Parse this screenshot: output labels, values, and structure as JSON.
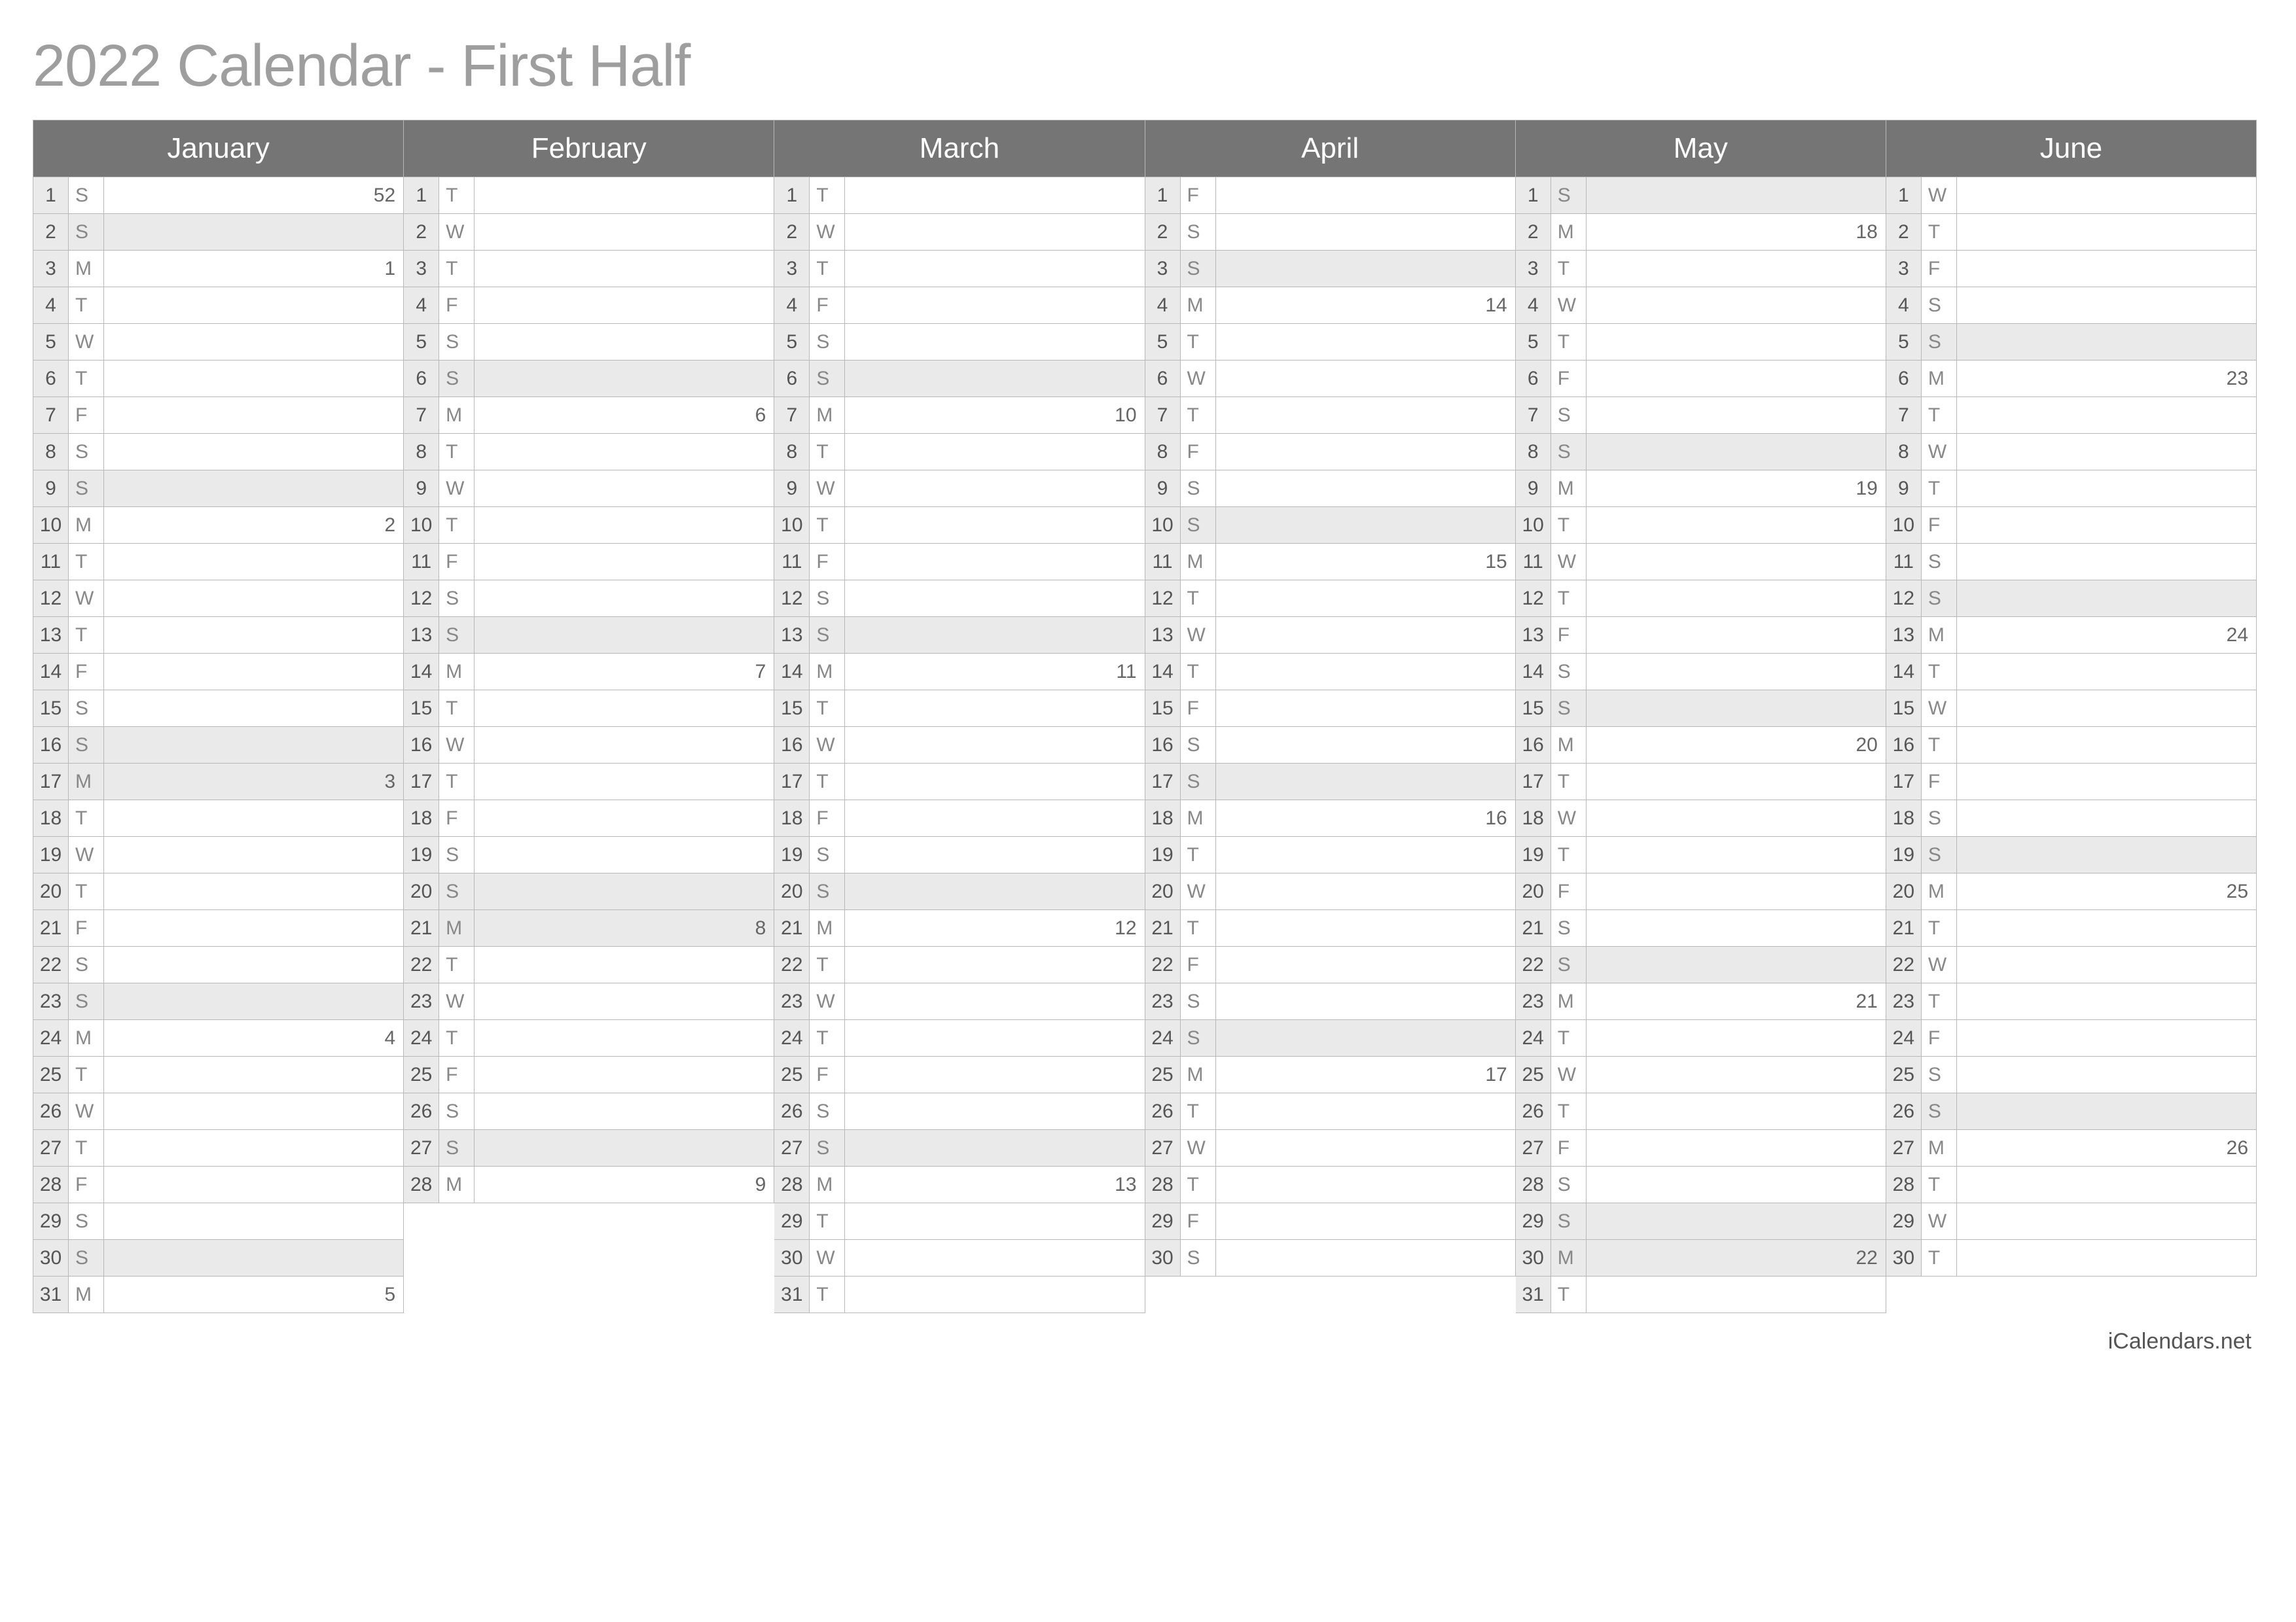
{
  "title": "2022 Calendar - First Half",
  "footer": "iCalendars.net",
  "months": [
    {
      "name": "January",
      "days": [
        {
          "n": 1,
          "d": "S",
          "w": "52",
          "shade": false
        },
        {
          "n": 2,
          "d": "S",
          "w": "",
          "shade": true
        },
        {
          "n": 3,
          "d": "M",
          "w": "1",
          "shade": false
        },
        {
          "n": 4,
          "d": "T",
          "w": "",
          "shade": false
        },
        {
          "n": 5,
          "d": "W",
          "w": "",
          "shade": false
        },
        {
          "n": 6,
          "d": "T",
          "w": "",
          "shade": false
        },
        {
          "n": 7,
          "d": "F",
          "w": "",
          "shade": false
        },
        {
          "n": 8,
          "d": "S",
          "w": "",
          "shade": false
        },
        {
          "n": 9,
          "d": "S",
          "w": "",
          "shade": true
        },
        {
          "n": 10,
          "d": "M",
          "w": "2",
          "shade": false
        },
        {
          "n": 11,
          "d": "T",
          "w": "",
          "shade": false
        },
        {
          "n": 12,
          "d": "W",
          "w": "",
          "shade": false
        },
        {
          "n": 13,
          "d": "T",
          "w": "",
          "shade": false
        },
        {
          "n": 14,
          "d": "F",
          "w": "",
          "shade": false
        },
        {
          "n": 15,
          "d": "S",
          "w": "",
          "shade": false
        },
        {
          "n": 16,
          "d": "S",
          "w": "",
          "shade": true
        },
        {
          "n": 17,
          "d": "M",
          "w": "3",
          "shade": true
        },
        {
          "n": 18,
          "d": "T",
          "w": "",
          "shade": false
        },
        {
          "n": 19,
          "d": "W",
          "w": "",
          "shade": false
        },
        {
          "n": 20,
          "d": "T",
          "w": "",
          "shade": false
        },
        {
          "n": 21,
          "d": "F",
          "w": "",
          "shade": false
        },
        {
          "n": 22,
          "d": "S",
          "w": "",
          "shade": false
        },
        {
          "n": 23,
          "d": "S",
          "w": "",
          "shade": true
        },
        {
          "n": 24,
          "d": "M",
          "w": "4",
          "shade": false
        },
        {
          "n": 25,
          "d": "T",
          "w": "",
          "shade": false
        },
        {
          "n": 26,
          "d": "W",
          "w": "",
          "shade": false
        },
        {
          "n": 27,
          "d": "T",
          "w": "",
          "shade": false
        },
        {
          "n": 28,
          "d": "F",
          "w": "",
          "shade": false
        },
        {
          "n": 29,
          "d": "S",
          "w": "",
          "shade": false
        },
        {
          "n": 30,
          "d": "S",
          "w": "",
          "shade": true
        },
        {
          "n": 31,
          "d": "M",
          "w": "5",
          "shade": false
        }
      ]
    },
    {
      "name": "February",
      "days": [
        {
          "n": 1,
          "d": "T",
          "w": "",
          "shade": false
        },
        {
          "n": 2,
          "d": "W",
          "w": "",
          "shade": false
        },
        {
          "n": 3,
          "d": "T",
          "w": "",
          "shade": false
        },
        {
          "n": 4,
          "d": "F",
          "w": "",
          "shade": false
        },
        {
          "n": 5,
          "d": "S",
          "w": "",
          "shade": false
        },
        {
          "n": 6,
          "d": "S",
          "w": "",
          "shade": true
        },
        {
          "n": 7,
          "d": "M",
          "w": "6",
          "shade": false
        },
        {
          "n": 8,
          "d": "T",
          "w": "",
          "shade": false
        },
        {
          "n": 9,
          "d": "W",
          "w": "",
          "shade": false
        },
        {
          "n": 10,
          "d": "T",
          "w": "",
          "shade": false
        },
        {
          "n": 11,
          "d": "F",
          "w": "",
          "shade": false
        },
        {
          "n": 12,
          "d": "S",
          "w": "",
          "shade": false
        },
        {
          "n": 13,
          "d": "S",
          "w": "",
          "shade": true
        },
        {
          "n": 14,
          "d": "M",
          "w": "7",
          "shade": false
        },
        {
          "n": 15,
          "d": "T",
          "w": "",
          "shade": false
        },
        {
          "n": 16,
          "d": "W",
          "w": "",
          "shade": false
        },
        {
          "n": 17,
          "d": "T",
          "w": "",
          "shade": false
        },
        {
          "n": 18,
          "d": "F",
          "w": "",
          "shade": false
        },
        {
          "n": 19,
          "d": "S",
          "w": "",
          "shade": false
        },
        {
          "n": 20,
          "d": "S",
          "w": "",
          "shade": true
        },
        {
          "n": 21,
          "d": "M",
          "w": "8",
          "shade": true
        },
        {
          "n": 22,
          "d": "T",
          "w": "",
          "shade": false
        },
        {
          "n": 23,
          "d": "W",
          "w": "",
          "shade": false
        },
        {
          "n": 24,
          "d": "T",
          "w": "",
          "shade": false
        },
        {
          "n": 25,
          "d": "F",
          "w": "",
          "shade": false
        },
        {
          "n": 26,
          "d": "S",
          "w": "",
          "shade": false
        },
        {
          "n": 27,
          "d": "S",
          "w": "",
          "shade": true
        },
        {
          "n": 28,
          "d": "M",
          "w": "9",
          "shade": false
        }
      ]
    },
    {
      "name": "March",
      "days": [
        {
          "n": 1,
          "d": "T",
          "w": "",
          "shade": false
        },
        {
          "n": 2,
          "d": "W",
          "w": "",
          "shade": false
        },
        {
          "n": 3,
          "d": "T",
          "w": "",
          "shade": false
        },
        {
          "n": 4,
          "d": "F",
          "w": "",
          "shade": false
        },
        {
          "n": 5,
          "d": "S",
          "w": "",
          "shade": false
        },
        {
          "n": 6,
          "d": "S",
          "w": "",
          "shade": true
        },
        {
          "n": 7,
          "d": "M",
          "w": "10",
          "shade": false
        },
        {
          "n": 8,
          "d": "T",
          "w": "",
          "shade": false
        },
        {
          "n": 9,
          "d": "W",
          "w": "",
          "shade": false
        },
        {
          "n": 10,
          "d": "T",
          "w": "",
          "shade": false
        },
        {
          "n": 11,
          "d": "F",
          "w": "",
          "shade": false
        },
        {
          "n": 12,
          "d": "S",
          "w": "",
          "shade": false
        },
        {
          "n": 13,
          "d": "S",
          "w": "",
          "shade": true
        },
        {
          "n": 14,
          "d": "M",
          "w": "11",
          "shade": false
        },
        {
          "n": 15,
          "d": "T",
          "w": "",
          "shade": false
        },
        {
          "n": 16,
          "d": "W",
          "w": "",
          "shade": false
        },
        {
          "n": 17,
          "d": "T",
          "w": "",
          "shade": false
        },
        {
          "n": 18,
          "d": "F",
          "w": "",
          "shade": false
        },
        {
          "n": 19,
          "d": "S",
          "w": "",
          "shade": false
        },
        {
          "n": 20,
          "d": "S",
          "w": "",
          "shade": true
        },
        {
          "n": 21,
          "d": "M",
          "w": "12",
          "shade": false
        },
        {
          "n": 22,
          "d": "T",
          "w": "",
          "shade": false
        },
        {
          "n": 23,
          "d": "W",
          "w": "",
          "shade": false
        },
        {
          "n": 24,
          "d": "T",
          "w": "",
          "shade": false
        },
        {
          "n": 25,
          "d": "F",
          "w": "",
          "shade": false
        },
        {
          "n": 26,
          "d": "S",
          "w": "",
          "shade": false
        },
        {
          "n": 27,
          "d": "S",
          "w": "",
          "shade": true
        },
        {
          "n": 28,
          "d": "M",
          "w": "13",
          "shade": false
        },
        {
          "n": 29,
          "d": "T",
          "w": "",
          "shade": false
        },
        {
          "n": 30,
          "d": "W",
          "w": "",
          "shade": false
        },
        {
          "n": 31,
          "d": "T",
          "w": "",
          "shade": false
        }
      ]
    },
    {
      "name": "April",
      "days": [
        {
          "n": 1,
          "d": "F",
          "w": "",
          "shade": false
        },
        {
          "n": 2,
          "d": "S",
          "w": "",
          "shade": false
        },
        {
          "n": 3,
          "d": "S",
          "w": "",
          "shade": true
        },
        {
          "n": 4,
          "d": "M",
          "w": "14",
          "shade": false
        },
        {
          "n": 5,
          "d": "T",
          "w": "",
          "shade": false
        },
        {
          "n": 6,
          "d": "W",
          "w": "",
          "shade": false
        },
        {
          "n": 7,
          "d": "T",
          "w": "",
          "shade": false
        },
        {
          "n": 8,
          "d": "F",
          "w": "",
          "shade": false
        },
        {
          "n": 9,
          "d": "S",
          "w": "",
          "shade": false
        },
        {
          "n": 10,
          "d": "S",
          "w": "",
          "shade": true
        },
        {
          "n": 11,
          "d": "M",
          "w": "15",
          "shade": false
        },
        {
          "n": 12,
          "d": "T",
          "w": "",
          "shade": false
        },
        {
          "n": 13,
          "d": "W",
          "w": "",
          "shade": false
        },
        {
          "n": 14,
          "d": "T",
          "w": "",
          "shade": false
        },
        {
          "n": 15,
          "d": "F",
          "w": "",
          "shade": false
        },
        {
          "n": 16,
          "d": "S",
          "w": "",
          "shade": false
        },
        {
          "n": 17,
          "d": "S",
          "w": "",
          "shade": true
        },
        {
          "n": 18,
          "d": "M",
          "w": "16",
          "shade": false
        },
        {
          "n": 19,
          "d": "T",
          "w": "",
          "shade": false
        },
        {
          "n": 20,
          "d": "W",
          "w": "",
          "shade": false
        },
        {
          "n": 21,
          "d": "T",
          "w": "",
          "shade": false
        },
        {
          "n": 22,
          "d": "F",
          "w": "",
          "shade": false
        },
        {
          "n": 23,
          "d": "S",
          "w": "",
          "shade": false
        },
        {
          "n": 24,
          "d": "S",
          "w": "",
          "shade": true
        },
        {
          "n": 25,
          "d": "M",
          "w": "17",
          "shade": false
        },
        {
          "n": 26,
          "d": "T",
          "w": "",
          "shade": false
        },
        {
          "n": 27,
          "d": "W",
          "w": "",
          "shade": false
        },
        {
          "n": 28,
          "d": "T",
          "w": "",
          "shade": false
        },
        {
          "n": 29,
          "d": "F",
          "w": "",
          "shade": false
        },
        {
          "n": 30,
          "d": "S",
          "w": "",
          "shade": false
        }
      ]
    },
    {
      "name": "May",
      "days": [
        {
          "n": 1,
          "d": "S",
          "w": "",
          "shade": true
        },
        {
          "n": 2,
          "d": "M",
          "w": "18",
          "shade": false
        },
        {
          "n": 3,
          "d": "T",
          "w": "",
          "shade": false
        },
        {
          "n": 4,
          "d": "W",
          "w": "",
          "shade": false
        },
        {
          "n": 5,
          "d": "T",
          "w": "",
          "shade": false
        },
        {
          "n": 6,
          "d": "F",
          "w": "",
          "shade": false
        },
        {
          "n": 7,
          "d": "S",
          "w": "",
          "shade": false
        },
        {
          "n": 8,
          "d": "S",
          "w": "",
          "shade": true
        },
        {
          "n": 9,
          "d": "M",
          "w": "19",
          "shade": false
        },
        {
          "n": 10,
          "d": "T",
          "w": "",
          "shade": false
        },
        {
          "n": 11,
          "d": "W",
          "w": "",
          "shade": false
        },
        {
          "n": 12,
          "d": "T",
          "w": "",
          "shade": false
        },
        {
          "n": 13,
          "d": "F",
          "w": "",
          "shade": false
        },
        {
          "n": 14,
          "d": "S",
          "w": "",
          "shade": false
        },
        {
          "n": 15,
          "d": "S",
          "w": "",
          "shade": true
        },
        {
          "n": 16,
          "d": "M",
          "w": "20",
          "shade": false
        },
        {
          "n": 17,
          "d": "T",
          "w": "",
          "shade": false
        },
        {
          "n": 18,
          "d": "W",
          "w": "",
          "shade": false
        },
        {
          "n": 19,
          "d": "T",
          "w": "",
          "shade": false
        },
        {
          "n": 20,
          "d": "F",
          "w": "",
          "shade": false
        },
        {
          "n": 21,
          "d": "S",
          "w": "",
          "shade": false
        },
        {
          "n": 22,
          "d": "S",
          "w": "",
          "shade": true
        },
        {
          "n": 23,
          "d": "M",
          "w": "21",
          "shade": false
        },
        {
          "n": 24,
          "d": "T",
          "w": "",
          "shade": false
        },
        {
          "n": 25,
          "d": "W",
          "w": "",
          "shade": false
        },
        {
          "n": 26,
          "d": "T",
          "w": "",
          "shade": false
        },
        {
          "n": 27,
          "d": "F",
          "w": "",
          "shade": false
        },
        {
          "n": 28,
          "d": "S",
          "w": "",
          "shade": false
        },
        {
          "n": 29,
          "d": "S",
          "w": "",
          "shade": true
        },
        {
          "n": 30,
          "d": "M",
          "w": "22",
          "shade": true
        },
        {
          "n": 31,
          "d": "T",
          "w": "",
          "shade": false
        }
      ]
    },
    {
      "name": "June",
      "days": [
        {
          "n": 1,
          "d": "W",
          "w": "",
          "shade": false
        },
        {
          "n": 2,
          "d": "T",
          "w": "",
          "shade": false
        },
        {
          "n": 3,
          "d": "F",
          "w": "",
          "shade": false
        },
        {
          "n": 4,
          "d": "S",
          "w": "",
          "shade": false
        },
        {
          "n": 5,
          "d": "S",
          "w": "",
          "shade": true
        },
        {
          "n": 6,
          "d": "M",
          "w": "23",
          "shade": false
        },
        {
          "n": 7,
          "d": "T",
          "w": "",
          "shade": false
        },
        {
          "n": 8,
          "d": "W",
          "w": "",
          "shade": false
        },
        {
          "n": 9,
          "d": "T",
          "w": "",
          "shade": false
        },
        {
          "n": 10,
          "d": "F",
          "w": "",
          "shade": false
        },
        {
          "n": 11,
          "d": "S",
          "w": "",
          "shade": false
        },
        {
          "n": 12,
          "d": "S",
          "w": "",
          "shade": true
        },
        {
          "n": 13,
          "d": "M",
          "w": "24",
          "shade": false
        },
        {
          "n": 14,
          "d": "T",
          "w": "",
          "shade": false
        },
        {
          "n": 15,
          "d": "W",
          "w": "",
          "shade": false
        },
        {
          "n": 16,
          "d": "T",
          "w": "",
          "shade": false
        },
        {
          "n": 17,
          "d": "F",
          "w": "",
          "shade": false
        },
        {
          "n": 18,
          "d": "S",
          "w": "",
          "shade": false
        },
        {
          "n": 19,
          "d": "S",
          "w": "",
          "shade": true
        },
        {
          "n": 20,
          "d": "M",
          "w": "25",
          "shade": false
        },
        {
          "n": 21,
          "d": "T",
          "w": "",
          "shade": false
        },
        {
          "n": 22,
          "d": "W",
          "w": "",
          "shade": false
        },
        {
          "n": 23,
          "d": "T",
          "w": "",
          "shade": false
        },
        {
          "n": 24,
          "d": "F",
          "w": "",
          "shade": false
        },
        {
          "n": 25,
          "d": "S",
          "w": "",
          "shade": false
        },
        {
          "n": 26,
          "d": "S",
          "w": "",
          "shade": true
        },
        {
          "n": 27,
          "d": "M",
          "w": "26",
          "shade": false
        },
        {
          "n": 28,
          "d": "T",
          "w": "",
          "shade": false
        },
        {
          "n": 29,
          "d": "W",
          "w": "",
          "shade": false
        },
        {
          "n": 30,
          "d": "T",
          "w": "",
          "shade": false
        }
      ]
    }
  ]
}
